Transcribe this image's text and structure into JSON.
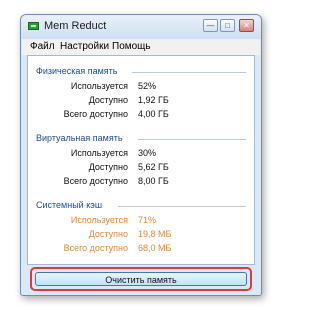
{
  "window": {
    "title": "Mem Reduct",
    "controls": {
      "minimize": "—",
      "maximize": "□",
      "close": "✕"
    }
  },
  "menu": [
    "Файл",
    "Настройки",
    "Помощь"
  ],
  "groups": [
    {
      "header": "Физическая память",
      "rows": [
        {
          "label": "Используется",
          "value": "52%"
        },
        {
          "label": "Доступно",
          "value": "1,92 ГБ"
        },
        {
          "label": "Всего доступно",
          "value": "4,00 ГБ"
        }
      ]
    },
    {
      "header": "Виртуальная память",
      "rows": [
        {
          "label": "Используется",
          "value": "30%"
        },
        {
          "label": "Доступно",
          "value": "5,62 ГБ"
        },
        {
          "label": "Всего доступно",
          "value": "8,00 ГБ"
        }
      ]
    },
    {
      "header": "Системный кэш",
      "rows": [
        {
          "label": "Используется",
          "value": "71%"
        },
        {
          "label": "Доступно",
          "value": "19,8 МБ"
        },
        {
          "label": "Всего доступно",
          "value": "68,0 МБ"
        }
      ]
    }
  ],
  "clean_button_label": "Очистить память",
  "colors": {
    "header_text": "#1f4e8f",
    "system_cache_text": "#e0893a",
    "highlight_frame": "#d63c3c"
  }
}
